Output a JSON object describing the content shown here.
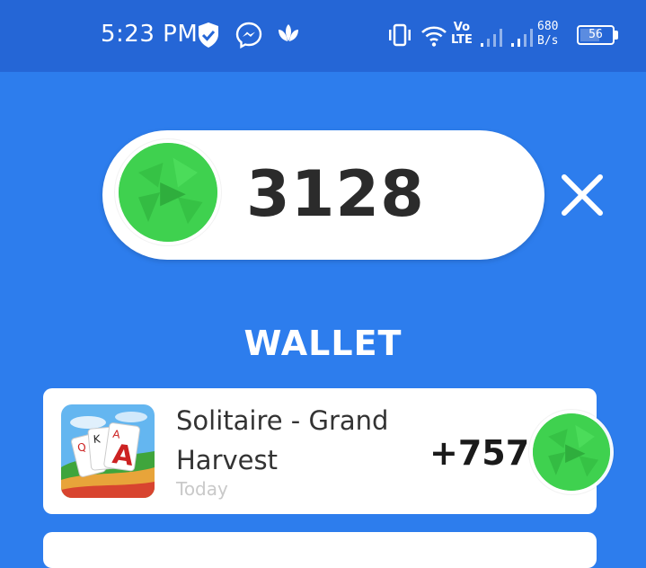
{
  "status_bar": {
    "time": "5:23 PM",
    "net_speed_value": "680",
    "net_speed_unit": "B/s",
    "volte_top": "Vo",
    "volte_bottom": "LTE",
    "battery_level": "56",
    "color": "#2566d6"
  },
  "balance": {
    "amount": "3128",
    "coin_color": "#3fd14f"
  },
  "wallet": {
    "title": "WALLET",
    "items": [
      {
        "app_name": "Solitaire - Grand Harvest",
        "date": "Today",
        "amount": "+757",
        "icon": "solitaire-grand-harvest-app-icon"
      }
    ]
  },
  "colors": {
    "background": "#2d7ded",
    "card": "#ffffff",
    "coin": "#3fd14f"
  }
}
